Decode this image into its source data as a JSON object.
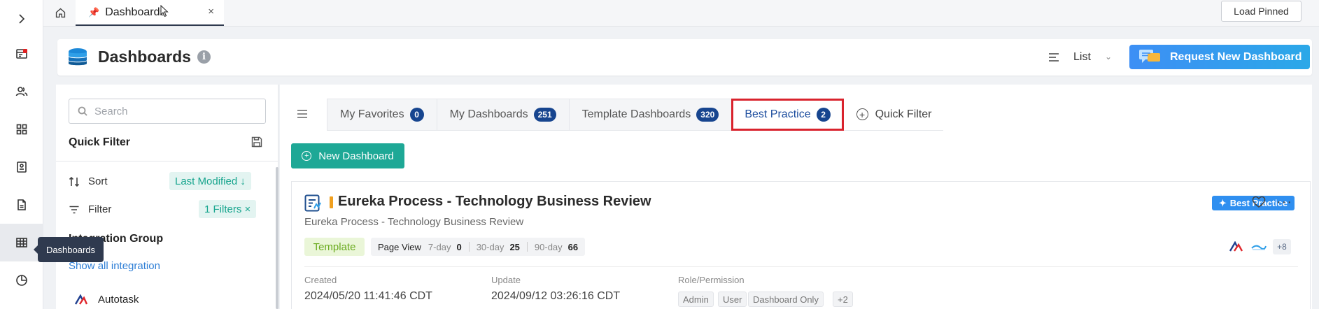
{
  "tabstrip": {
    "home_icon": "home-icon",
    "active_tab": "Dashboards",
    "pin_icon": "pushpin-icon",
    "close_icon": "close-icon",
    "load_pinned": "Load Pinned"
  },
  "rail": {
    "items": [
      {
        "icon": "chevron-right-icon"
      },
      {
        "icon": "report-icon"
      },
      {
        "icon": "users-icon"
      },
      {
        "icon": "grid-icon"
      },
      {
        "icon": "form-icon"
      },
      {
        "icon": "document-icon"
      },
      {
        "icon": "table-icon"
      },
      {
        "icon": "pie-chart-icon"
      }
    ],
    "tooltip": "Dashboards"
  },
  "header": {
    "title": "Dashboards",
    "view_label": "List",
    "request_button": "Request New Dashboard"
  },
  "filter_panel": {
    "search_placeholder": "Search",
    "quick_filter_title": "Quick Filter",
    "sort_label": "Sort",
    "sort_value": "Last Modified ↓",
    "filter_label": "Filter",
    "filter_value": "1 Filters ×",
    "integration_group_title": "Integration Group",
    "show_all": "Show all integration",
    "integrations": [
      "Autotask"
    ]
  },
  "tabs": [
    {
      "label": "My Favorites",
      "count": "0"
    },
    {
      "label": "My Dashboards",
      "count": "251"
    },
    {
      "label": "Template Dashboards",
      "count": "320"
    },
    {
      "label": "Best Practice",
      "count": "2"
    }
  ],
  "quick_filter_label": "Quick Filter",
  "new_dashboard_button": "New Dashboard",
  "card": {
    "title": "Eureka Process - Technology Business Review",
    "subtitle": "Eureka Process - Technology Business Review",
    "badge": "Best Practice",
    "tag": "Template",
    "page_view_label": "Page View",
    "pv_7_label": "7-day",
    "pv_7": "0",
    "pv_30_label": "30-day",
    "pv_30": "25",
    "pv_90_label": "90-day",
    "pv_90": "66",
    "more_integrations": "+8",
    "created_label": "Created",
    "created_value": "2024/05/20 11:41:46 CDT",
    "update_label": "Update",
    "update_value": "2024/09/12 03:26:16 CDT",
    "role_label": "Role/Permission",
    "roles": [
      "Admin",
      "User",
      "Dashboard Only",
      "+2"
    ]
  },
  "colors": {
    "accent_teal": "#1ea896",
    "tab_badge": "#17458f",
    "highlight_red": "#d9232d",
    "request_blue": "#3d8ff5"
  }
}
